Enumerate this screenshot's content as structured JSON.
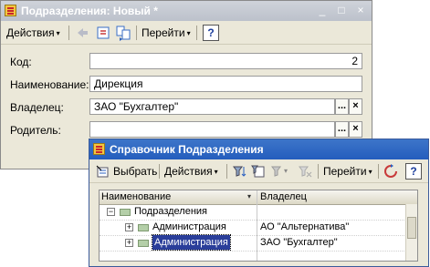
{
  "window1": {
    "title": "Подразделения: Новый *",
    "toolbar": {
      "actions_label": "Действия",
      "goto_label": "Перейти",
      "help_label": "?"
    },
    "fields": {
      "code_label": "Код:",
      "code_value": "2",
      "name_label": "Наименование:",
      "name_value": "Дирекция",
      "owner_label": "Владелец:",
      "owner_value": "ЗАО \"Бухгалтер\"",
      "parent_label": "Родитель:",
      "parent_value": ""
    }
  },
  "window2": {
    "title": "Справочник Подразделения",
    "toolbar": {
      "select_label": "Выбрать",
      "actions_label": "Действия",
      "goto_label": "Перейти",
      "help_label": "?"
    },
    "grid": {
      "columns": [
        "Наименование",
        "Владелец"
      ],
      "rows": [
        {
          "name": "Подразделения",
          "owner": ""
        },
        {
          "name": "Администрация",
          "owner": "АО \"Альтернатива\""
        },
        {
          "name": "Администрация",
          "owner": "ЗАО \"Бухгалтер\""
        }
      ]
    }
  },
  "glyphs": {
    "select_button": "...",
    "clear_button": "×",
    "minimize": "_",
    "maximize": "□",
    "close": "×",
    "collapse": "−",
    "expand": "+",
    "dropdown_arrow": "▾",
    "sort_arrow": "▾"
  }
}
